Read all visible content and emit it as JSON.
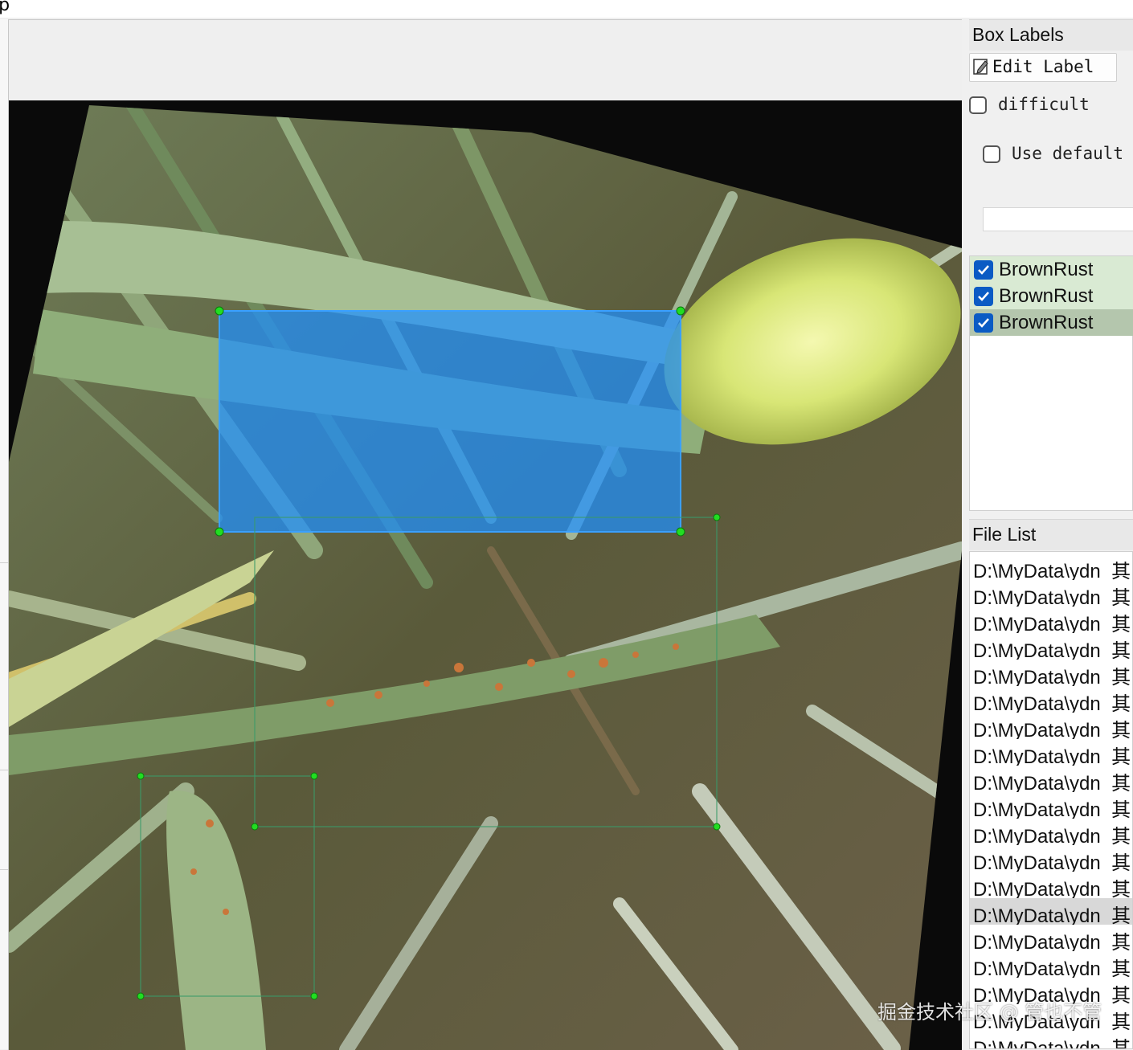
{
  "menubar": {
    "help_partial": "lp"
  },
  "canvas": {
    "image_description": "wheat leaves with brown rust, rotated photo",
    "boxes": [
      {
        "label": "BrownRust",
        "state": "selected-filled"
      },
      {
        "label": "BrownRust",
        "state": "outline"
      },
      {
        "label": "BrownRust",
        "state": "outline"
      }
    ]
  },
  "box_labels": {
    "title": "Box Labels",
    "edit_label_button": "Edit Label",
    "difficult_label": "difficult",
    "use_default_label": "Use default l",
    "default_label_value": "",
    "items": [
      {
        "label": "BrownRust",
        "checked": true
      },
      {
        "label": "BrownRust",
        "checked": true
      },
      {
        "label": "BrownRust",
        "checked": true
      }
    ]
  },
  "file_list": {
    "title": "File List",
    "items": [
      "D:\\MyData\\ydn_其",
      "D:\\MyData\\ydn_其",
      "D:\\MyData\\ydn_其",
      "D:\\MyData\\ydn_其",
      "D:\\MyData\\ydn_其",
      "D:\\MyData\\ydn_其",
      "D:\\MyData\\ydn_其",
      "D:\\MyData\\ydn_其",
      "D:\\MyData\\ydn_其",
      "D:\\MyData\\ydn_其",
      "D:\\MyData\\ydn_其",
      "D:\\MyData\\ydn_其",
      "D:\\MyData\\ydn_其",
      "D:\\MyData\\ydn_其",
      "D:\\MyData\\ydn_其",
      "D:\\MyData\\ydn_其",
      "D:\\MyData\\ydn_其",
      "D:\\MyData\\ydn_其",
      "D:\\MyData\\ydn_其"
    ],
    "selected_index": 13
  },
  "watermark": "掘金技术社区 @ 管也不管",
  "colors": {
    "box_fill": "#1e90ff",
    "handle": "#22dd22",
    "accent": "#0a5bc4"
  }
}
